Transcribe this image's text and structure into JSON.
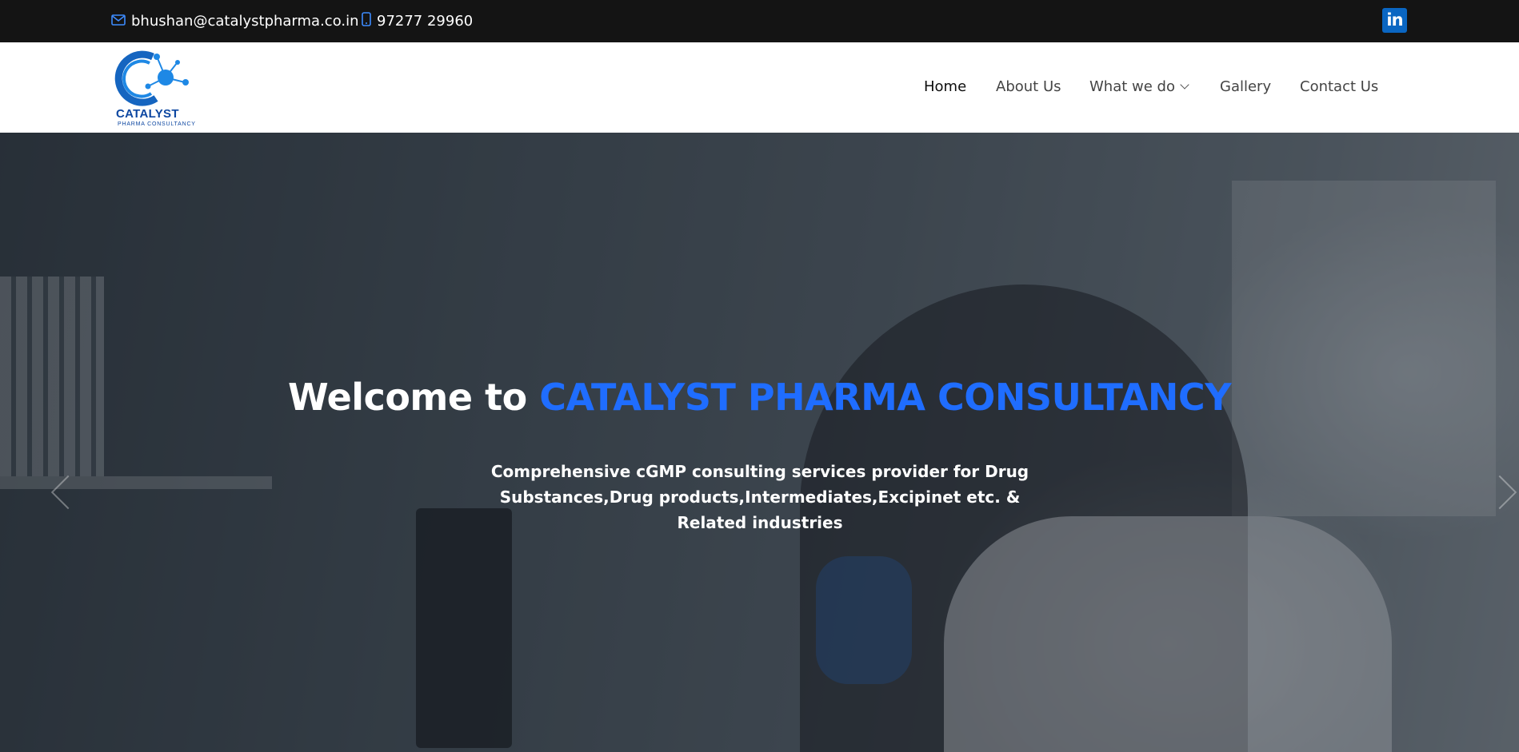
{
  "topbar": {
    "email": "bhushan@catalystpharma.co.in",
    "phone": "97277 29960",
    "social_icon": "linkedin-icon",
    "social_label": "in"
  },
  "logo": {
    "name": "CATALYST",
    "tagline": "PHARMA CONSULTANCY"
  },
  "nav": {
    "items": [
      {
        "label": "Home",
        "active": true
      },
      {
        "label": "About Us"
      },
      {
        "label": "What we do",
        "dropdown": true
      },
      {
        "label": "Gallery"
      },
      {
        "label": "Contact Us"
      }
    ]
  },
  "hero": {
    "title_prefix": "Welcome to",
    "title_highlight": "CATALYST PHARMA CONSULTANCY",
    "subtitle": "Comprehensive cGMP consulting services provider for Drug Substances,Drug products,Intermediates,Excipinet etc. & Related industries"
  },
  "colors": {
    "topbar_bg": "#141414",
    "accent": "#1f6dff",
    "brand_blue": "#0d47a1",
    "linkedin": "#0a66c2"
  }
}
